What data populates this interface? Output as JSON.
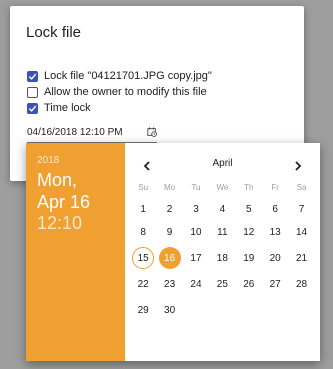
{
  "colors": {
    "accent": "#f0a030",
    "checkbox": "#3f51b5"
  },
  "dialog": {
    "title": "Lock file",
    "options": [
      {
        "label": "Lock file \"04121701.JPG copy.jpg\"",
        "checked": true
      },
      {
        "label": "Allow the owner to modify this file",
        "checked": false
      },
      {
        "label": "Time lock",
        "checked": true
      }
    ],
    "datetime_value": "04/16/2018 12:10 PM",
    "calendar_icon": "calendar-clock-icon"
  },
  "picker": {
    "year": "2018",
    "weekday_date": "Mon,",
    "month_day": "Apr 16",
    "time": "12:10",
    "month": "April",
    "prev_icon": "chevron-left-icon",
    "next_icon": "chevron-right-icon",
    "weekdays": [
      "Su",
      "Mo",
      "Tu",
      "We",
      "Th",
      "Fr",
      "Sa"
    ],
    "days": [
      "1",
      "2",
      "3",
      "4",
      "5",
      "6",
      "7",
      "8",
      "9",
      "10",
      "11",
      "12",
      "13",
      "14",
      "15",
      "16",
      "17",
      "18",
      "19",
      "20",
      "21",
      "22",
      "23",
      "24",
      "25",
      "26",
      "27",
      "28",
      "29",
      "30"
    ],
    "today": "15",
    "selected": "16"
  }
}
